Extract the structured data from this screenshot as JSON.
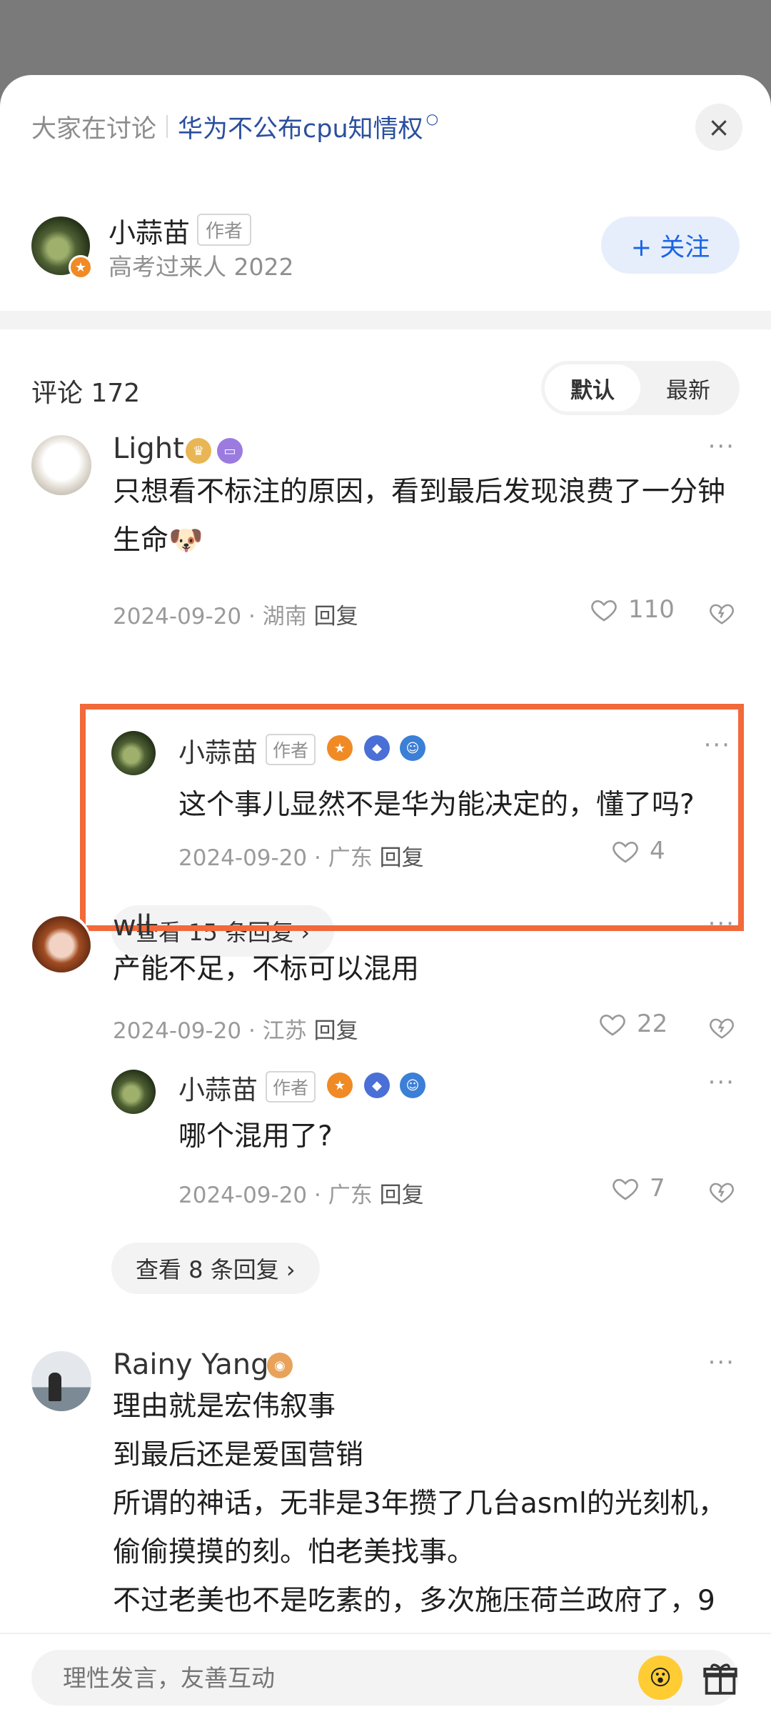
{
  "header": {
    "topic_prefix": "大家在讨论",
    "topic_link": "华为不公布cpu知情权",
    "close_icon": "×"
  },
  "author": {
    "name": "小蒜苗",
    "tag": "作者",
    "subtitle": "高考过来人 2022",
    "follow_label": "+ 关注"
  },
  "comments_section": {
    "count_label": "评论 172",
    "sort_options": [
      "默认",
      "最新"
    ],
    "active_sort": "默认"
  },
  "comments": [
    {
      "name": "Light",
      "text": "只想看不标注的原因，看到最后发现浪费了一分钟生命",
      "emoji": "🐶",
      "meta": "2024-09-20 · 湖南",
      "reply_label": "回复",
      "likes": "110",
      "reply": {
        "name": "小蒜苗",
        "tag": "作者",
        "text": "这个事儿显然不是华为能决定的，懂了吗?",
        "meta": "2024-09-20 · 广东",
        "reply_label": "回复",
        "likes": "4"
      },
      "more_replies": "查看 15 条回复 ›"
    },
    {
      "name": "wll",
      "text": "产能不足，不标可以混用",
      "meta": "2024-09-20 · 江苏",
      "reply_label": "回复",
      "likes": "22",
      "reply": {
        "name": "小蒜苗",
        "tag": "作者",
        "text": "哪个混用了?",
        "meta": "2024-09-20 · 广东",
        "reply_label": "回复",
        "likes": "7"
      },
      "more_replies": "查看 8 条回复 ›"
    },
    {
      "name": "Rainy Yang",
      "lines": [
        "理由就是宏伟叙事",
        "到最后还是爱国营销",
        "所谓的神话，无非是3年攒了几台asml的光刻机，",
        "偷偷摸摸的刻。怕老美找事。",
        "不过老美也不是吃素的，多次施压荷兰政府了，9"
      ]
    }
  ],
  "bottom_bar": {
    "placeholder": "理性发言，友善互动"
  },
  "colors": {
    "link": "#2a4f9e",
    "follow_text": "#1a64e6",
    "highlight": "#f2693a"
  },
  "icons": [
    "close-icon",
    "more-icon",
    "heart-icon",
    "dislike-icon",
    "emoji-icon",
    "gift-icon",
    "search-icon"
  ]
}
